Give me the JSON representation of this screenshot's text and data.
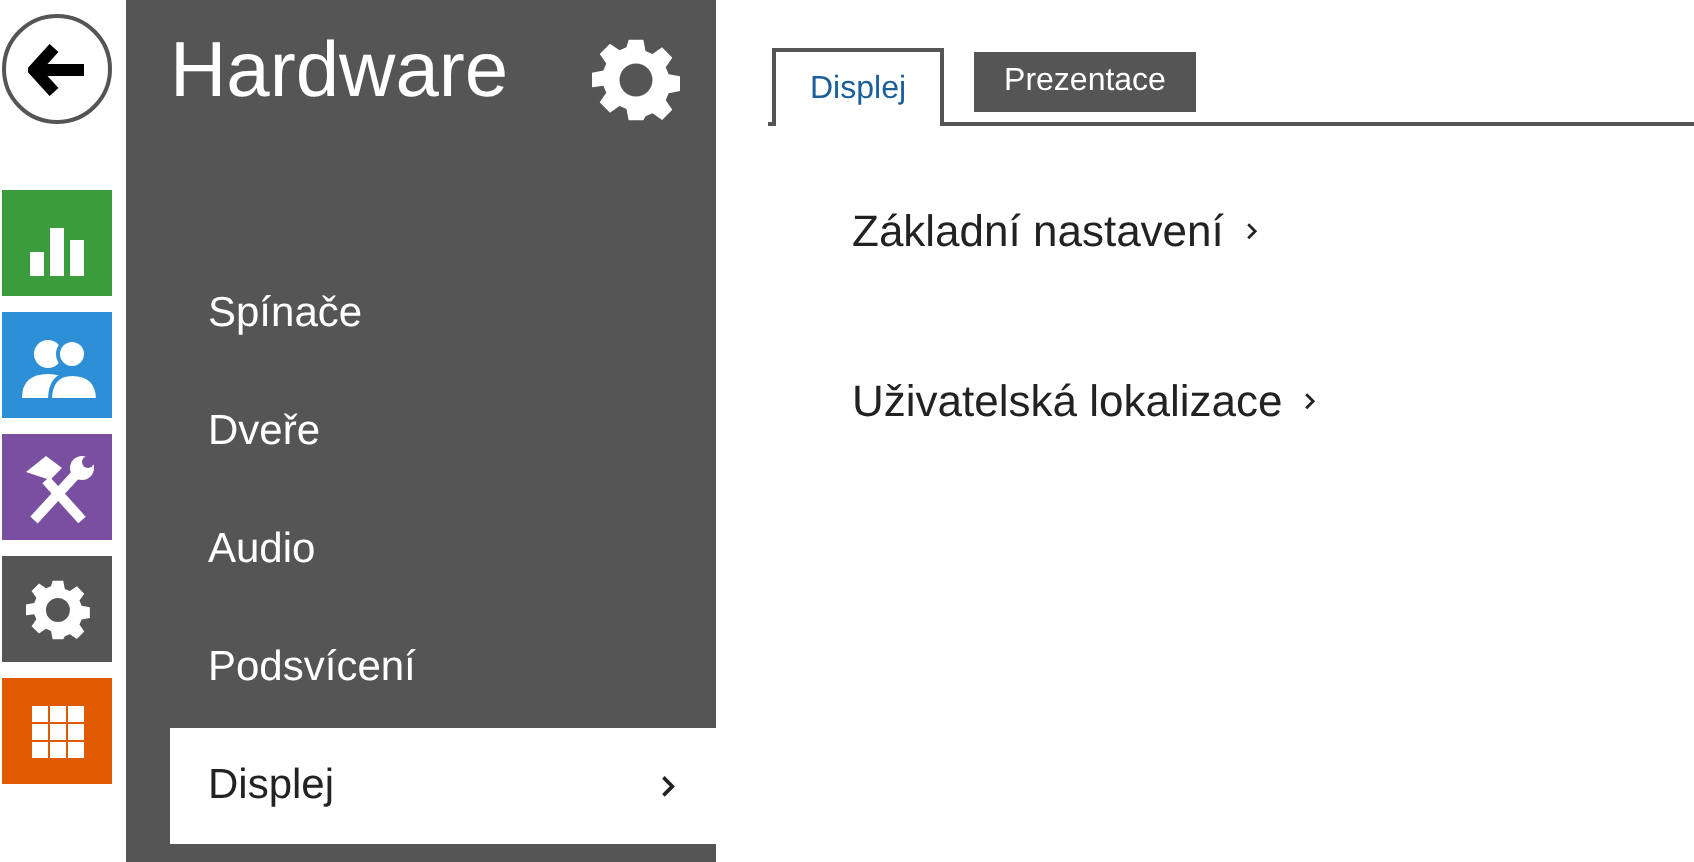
{
  "app_nav": [
    {
      "kind": "status"
    },
    {
      "kind": "directory"
    },
    {
      "kind": "hardware"
    },
    {
      "kind": "system"
    },
    {
      "kind": "services"
    }
  ],
  "sidebar": {
    "title": "Hardware",
    "items": [
      {
        "label": "Spínače",
        "selected": false
      },
      {
        "label": "Dveře",
        "selected": false
      },
      {
        "label": "Audio",
        "selected": false
      },
      {
        "label": "Podsvícení",
        "selected": false
      },
      {
        "label": "Displej",
        "selected": true
      }
    ]
  },
  "tabs": [
    {
      "label": "Displej",
      "selected": true
    },
    {
      "label": "Prezentace",
      "selected": false
    }
  ],
  "links": [
    {
      "label": "Základní nastavení"
    },
    {
      "label": "Uživatelská lokalizace"
    }
  ]
}
